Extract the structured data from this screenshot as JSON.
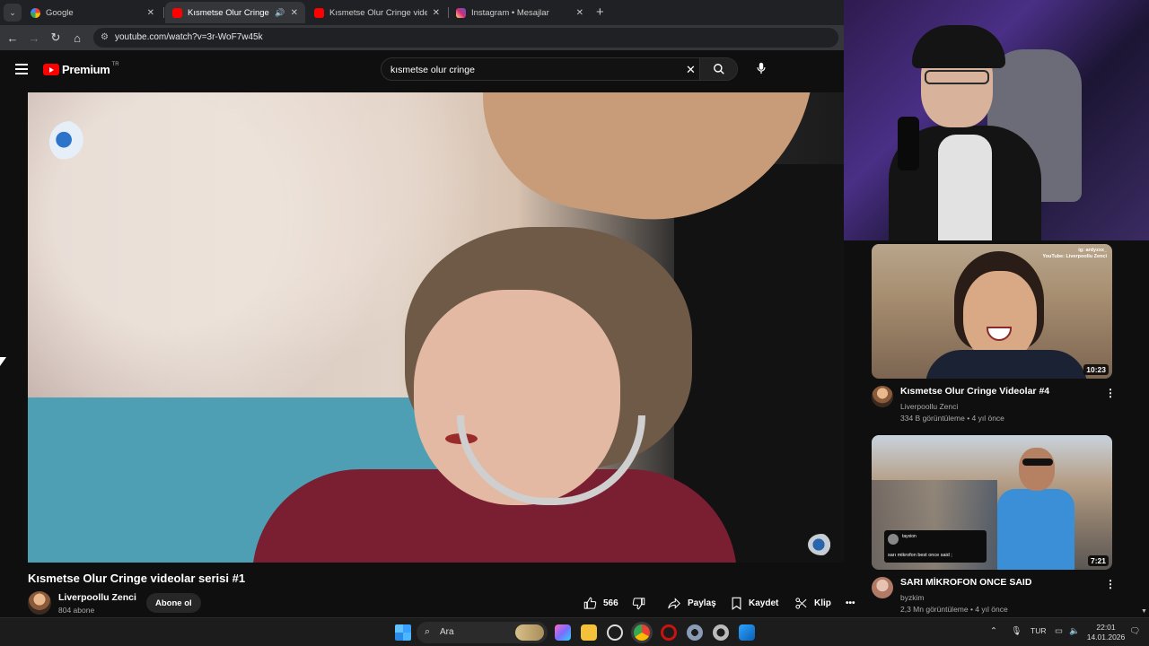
{
  "browser": {
    "tabs": [
      {
        "title": "Google",
        "favicon_color": "#4285f4",
        "active": false
      },
      {
        "title": "Kısmetse Olur Cringe videoları",
        "favicon_color": "#ff0000",
        "active": true
      },
      {
        "title": "Kısmetse Olur Cringe videolar #",
        "favicon_color": "#ff0000",
        "active": false
      },
      {
        "title": "Instagram • Mesajlar",
        "favicon_color": "#e1306c",
        "active": false
      }
    ],
    "new_tab": "+",
    "url": "youtube.com/watch?v=3r-WoF7w45k"
  },
  "youtube": {
    "logo_word": "Premium",
    "logo_country": "TR",
    "search_query": "kısmetse olur cringe",
    "video_title": "Kısmetse Olur Cringe videolar serisi #1",
    "channel_name": "Liverpoollu Zenci",
    "channel_subs": "804 abone",
    "subscribe_label": "Abone ol",
    "like_count": "566",
    "share_label": "Paylaş",
    "save_label": "Kaydet",
    "clip_label": "Klip",
    "more_label": "•••"
  },
  "recommendations": [
    {
      "title": "Kısmetse Olur Cringe Videolar #4",
      "channel": "Liverpoollu Zenci",
      "meta": "334 B görüntüleme • 4 yıl önce",
      "duration": "10:23",
      "thumb_tag": "ig: ardyzxx_\nYouTube: Liverpoollu Zenci"
    },
    {
      "title": "SARI MİKROFON ONCE SAID",
      "channel": "byzkim",
      "meta": "2,3 Mn görüntüleme • 4 yıl önce",
      "duration": "7:21",
      "tweet_user": "tayxion",
      "tweet_text": "sarı mikrofon best once said ;"
    }
  ],
  "taskbar": {
    "search_label": "Ara",
    "language": "TUR",
    "time": "22:01",
    "date": "14.01.2026"
  }
}
